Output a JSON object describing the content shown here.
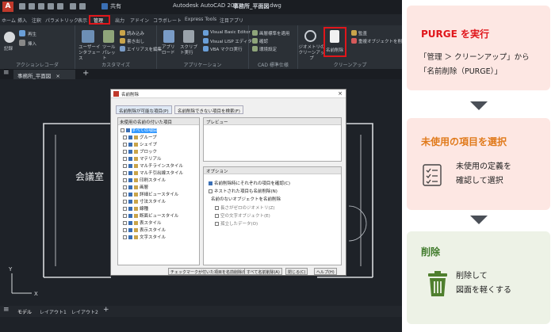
{
  "titlebar": {
    "app_title": "Autodesk AutoCAD 202",
    "file_name": "事務所_平面図",
    "file_ext": ".dwg",
    "share_label": "共有"
  },
  "ribbon_tabs": [
    "ホーム",
    "挿入",
    "注釈",
    "パラメトリック",
    "表示",
    "管理",
    "出力",
    "アドイン",
    "コラボレート",
    "Express Tools",
    "注目アプリ"
  ],
  "highlighted_tab": "管理",
  "ribbon": {
    "groups": [
      {
        "label": "アクションレコーダ",
        "items": [
          "記録",
          "再生",
          "挿入",
          "再生"
        ]
      },
      {
        "label": "カスタマイズ",
        "items": [
          "ユーザーインタフェース",
          "ツールパレット",
          "読み込み",
          "書き出し",
          "エイリアスを編集"
        ]
      },
      {
        "label": "アプリケーション",
        "items": [
          "アプリロード",
          "スクリプト実行",
          "Visual Basic Editor",
          "Visual LISP エディタ",
          "VBA マクロ実行"
        ]
      },
      {
        "label": "CAD 標準仕様",
        "items": [
          "画層標準を適用",
          "確認",
          "環境設定"
        ]
      },
      {
        "label": "クリーンアップ",
        "items": [
          "ジオメトリのクリーンアップ",
          "名前削除",
          "監査",
          "重複オブジェクトを削除"
        ]
      }
    ]
  },
  "file_tab": "事務所_平面図",
  "canvas": {
    "room_label": "会議室",
    "axis_y": "Y",
    "axis_x": "X"
  },
  "bottom_tabs": [
    "モデル",
    "レイアウト1",
    "レイアウト2"
  ],
  "dialog": {
    "title": "名前削除",
    "tabs": [
      "名前削除が可能な項目(P)",
      "名前削除できない項目を検索(F)"
    ],
    "tree_header": "未使用の名前の付いた項目",
    "tree_root": "すべての項目",
    "tree_items": [
      "グループ",
      "シェイプ",
      "ブロック",
      "マテリアル",
      "マルチラインスタイル",
      "マルチ引出線スタイル",
      "印刷スタイル",
      "画層",
      "詳細ビュースタイル",
      "寸法スタイル",
      "線種",
      "断面ビュースタイル",
      "表スタイル",
      "表示スタイル",
      "文字スタイル"
    ],
    "preview_label": "プレビュー",
    "options_label": "オプション",
    "options": [
      {
        "label": "名前削除時にそれぞれの項目を確認(C)",
        "checked": true
      },
      {
        "label": "ネストされた項目も名前削除(N)",
        "checked": false
      }
    ],
    "unnamed_label": "名前のないオブジェクトを名前削除",
    "unnamed_options": [
      "長さがゼロのジオメトリ(Z)",
      "空の文字オブジェクト(E)",
      "孤立したデータ(O)"
    ],
    "buttons": [
      "チェックマークが付いた項目を名前削除(U)",
      "すべて名前削除(A)",
      "閉じる(C)",
      "ヘルプ(H)"
    ]
  },
  "steps": [
    {
      "title": "PURGE を実行",
      "title_color": "#e0161b",
      "lines": [
        "「管理 ＞ クリーンアップ」から",
        "「名前削除（PURGE）」"
      ]
    },
    {
      "title": "未使用の項目を選択",
      "title_color": "#e07a1b",
      "icon": "checklist-icon",
      "lines": [
        "未使用の定義を",
        "確認して選択"
      ]
    },
    {
      "title": "削除",
      "title_color": "#3f7a2a",
      "icon": "trash-icon",
      "lines": [
        "削除して",
        "図面を軽くする"
      ]
    }
  ]
}
